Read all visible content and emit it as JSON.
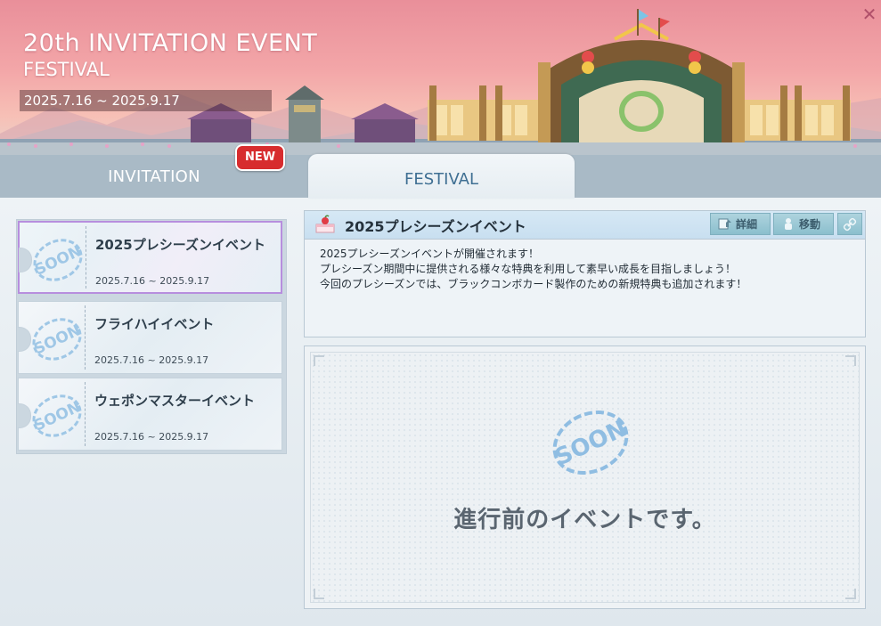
{
  "banner": {
    "title": "20th INVITATION EVENT",
    "subtitle": "FESTIVAL",
    "period": "2025.7.16 ~ 2025.9.17"
  },
  "tabs": {
    "invitation": "INVITATION",
    "festival": "FESTIVAL",
    "new_badge": "NEW"
  },
  "events": [
    {
      "title": "2025プレシーズンイベント",
      "period": "2025.7.16 ~ 2025.9.17",
      "selected": true
    },
    {
      "title": "フライハイイベント",
      "period": "2025.7.16 ~ 2025.9.17",
      "selected": false
    },
    {
      "title": "ウェポンマスターイベント",
      "period": "2025.7.16 ~ 2025.9.17",
      "selected": false
    }
  ],
  "detail": {
    "title": "2025プレシーズンイベント",
    "buttons": {
      "details": "詳細",
      "move": "移動"
    },
    "description": [
      "2025プレシーズンイベントが開催されます！",
      "プレシーズン期間中に提供される様々な特典を利用して素早い成長を目指しましょう！",
      "今回のプレシーズンでは、ブラックコンボカード製作のための新規特典も追加されます！"
    ]
  },
  "main": {
    "pending_text": "進行前のイベントです。"
  },
  "icons": [
    "close-icon",
    "cake-icon",
    "details-icon",
    "move-icon",
    "link-icon",
    "soon-stamp-icon"
  ],
  "colors": {
    "accent": "#3f6f93",
    "badge": "#d72c2e",
    "selected_border": "#b78ede"
  }
}
